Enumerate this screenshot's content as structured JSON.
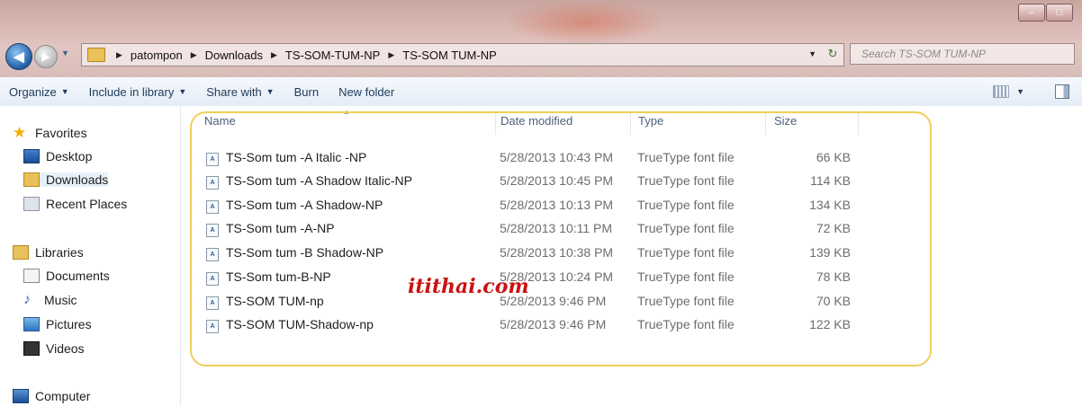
{
  "address_bar": {
    "breadcrumbs": [
      "patompon",
      "Downloads",
      "TS-SOM-TUM-NP",
      "TS-SOM TUM-NP"
    ],
    "search_placeholder": "Search TS-SOM TUM-NP"
  },
  "toolbar": {
    "organize": "Organize",
    "include_in_library": "Include in library",
    "share_with": "Share with",
    "burn": "Burn",
    "new_folder": "New folder"
  },
  "sidebar": {
    "favorites": "Favorites",
    "desktop": "Desktop",
    "downloads": "Downloads",
    "recent_places": "Recent Places",
    "libraries": "Libraries",
    "documents": "Documents",
    "music": "Music",
    "pictures": "Pictures",
    "videos": "Videos",
    "computer": "Computer"
  },
  "columns": {
    "name": "Name",
    "date_modified": "Date modified",
    "type": "Type",
    "size": "Size"
  },
  "files": [
    {
      "name": "TS-Som tum -A Italic -NP",
      "date": "5/28/2013 10:43 PM",
      "type": "TrueType font file",
      "size": "66 KB"
    },
    {
      "name": "TS-Som tum -A Shadow Italic-NP",
      "date": "5/28/2013 10:45 PM",
      "type": "TrueType font file",
      "size": "114 KB"
    },
    {
      "name": "TS-Som tum -A Shadow-NP",
      "date": "5/28/2013 10:13 PM",
      "type": "TrueType font file",
      "size": "134 KB"
    },
    {
      "name": "TS-Som tum -A-NP",
      "date": "5/28/2013 10:11 PM",
      "type": "TrueType font file",
      "size": "72 KB"
    },
    {
      "name": "TS-Som tum -B Shadow-NP",
      "date": "5/28/2013 10:38 PM",
      "type": "TrueType font file",
      "size": "139 KB"
    },
    {
      "name": "TS-Som tum-B-NP",
      "date": "5/28/2013 10:24 PM",
      "type": "TrueType font file",
      "size": "78 KB"
    },
    {
      "name": "TS-SOM TUM-np",
      "date": "5/28/2013 9:46 PM",
      "type": "TrueType font file",
      "size": "70 KB"
    },
    {
      "name": "TS-SOM TUM-Shadow-np",
      "date": "5/28/2013 9:46 PM",
      "type": "TrueType font file",
      "size": "122 KB"
    }
  ],
  "watermark": "itithai.com",
  "colors": {
    "titlebar": "#d9b8b3",
    "highlight_border": "#f0cf5c",
    "watermark": "#cc1111",
    "toolbar_text": "#1e395b"
  }
}
